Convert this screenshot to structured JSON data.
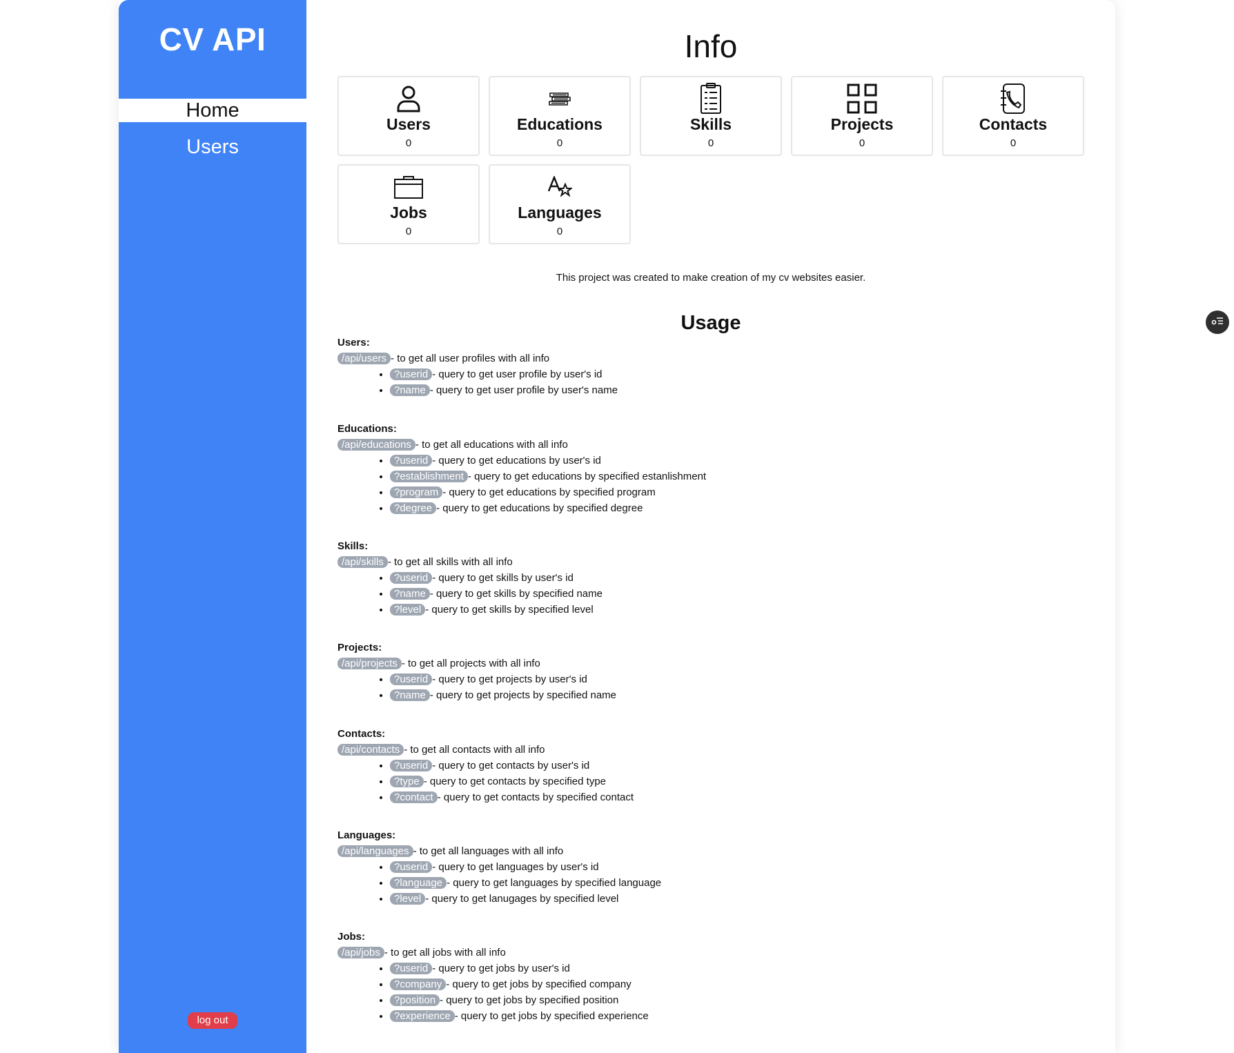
{
  "app": {
    "brand": "CV API"
  },
  "sidebar": {
    "items": [
      {
        "label": "Home",
        "active": true
      },
      {
        "label": "Users",
        "active": false
      }
    ],
    "logout_label": "log out"
  },
  "main": {
    "title": "Info",
    "cards": [
      {
        "label": "Users",
        "count": "0",
        "icon": "user-icon"
      },
      {
        "label": "Educations",
        "count": "0",
        "icon": "books-icon"
      },
      {
        "label": "Skills",
        "count": "0",
        "icon": "clipboard-list-icon"
      },
      {
        "label": "Projects",
        "count": "0",
        "icon": "grid-icon"
      },
      {
        "label": "Contacts",
        "count": "0",
        "icon": "address-book-icon"
      },
      {
        "label": "Jobs",
        "count": "0",
        "icon": "briefcase-icon"
      },
      {
        "label": "Languages",
        "count": "0",
        "icon": "translate-icon"
      }
    ],
    "description": "This project was created to make creation of my cv websites easier.",
    "usage_title": "Usage",
    "sections": [
      {
        "title": "Users:",
        "endpoint": "/api/users",
        "endpoint_desc": "- to get all user profiles with all info",
        "params": [
          {
            "tag": "?userid",
            "desc": "- query to get user profile by user's id"
          },
          {
            "tag": "?name",
            "desc": "- query to get user profile by user's name"
          }
        ]
      },
      {
        "title": "Educations:",
        "endpoint": "/api/educations",
        "endpoint_desc": "- to get all educations with all info",
        "params": [
          {
            "tag": "?userid",
            "desc": "- query to get educations by user's id"
          },
          {
            "tag": "?establishment",
            "desc": "- query to get educations by specified estanlishment"
          },
          {
            "tag": "?program",
            "desc": "- query to get educations by specified program"
          },
          {
            "tag": "?degree",
            "desc": "- query to get educations by specified degree"
          }
        ]
      },
      {
        "title": "Skills:",
        "endpoint": "/api/skills",
        "endpoint_desc": "- to get all skills with all info",
        "params": [
          {
            "tag": "?userid",
            "desc": "- query to get skills by user's id"
          },
          {
            "tag": "?name",
            "desc": "- query to get skills by specified name"
          },
          {
            "tag": "?level",
            "desc": "- query to get skills by specified level"
          }
        ]
      },
      {
        "title": "Projects:",
        "endpoint": "/api/projects",
        "endpoint_desc": "- to get all projects with all info",
        "params": [
          {
            "tag": "?userid",
            "desc": "- query to get projects by user's id"
          },
          {
            "tag": "?name",
            "desc": "- query to get projects by specified name"
          }
        ]
      },
      {
        "title": "Contacts:",
        "endpoint": "/api/contacts",
        "endpoint_desc": "- to get all contacts with all info",
        "params": [
          {
            "tag": "?userid",
            "desc": "- query to get contacts by user's id"
          },
          {
            "tag": "?type",
            "desc": "- query to get contacts by specified type"
          },
          {
            "tag": "?contact",
            "desc": "- query to get contacts by specified contact"
          }
        ]
      },
      {
        "title": "Languages:",
        "endpoint": "/api/languages",
        "endpoint_desc": "- to get all languages with all info",
        "params": [
          {
            "tag": "?userid",
            "desc": "- query to get languages by user's id"
          },
          {
            "tag": "?language",
            "desc": "- query to get languages by specified language"
          },
          {
            "tag": "?level",
            "desc": "- query to get lanugages by specified level"
          }
        ]
      },
      {
        "title": "Jobs:",
        "endpoint": "/api/jobs",
        "endpoint_desc": "- to get all jobs with all info",
        "params": [
          {
            "tag": "?userid",
            "desc": "- query to get jobs by user's id"
          },
          {
            "tag": "?company",
            "desc": "- query to get jobs by specified company"
          },
          {
            "tag": "?position",
            "desc": "- query to get jobs by specified position"
          },
          {
            "tag": "?experience",
            "desc": "- query to get jobs by specified experience"
          }
        ]
      }
    ]
  },
  "floating_button": {
    "icon": "chat-toggle-icon"
  },
  "colors": {
    "sidebar": "#3f83f6",
    "tag": "#9ea6b2",
    "logout": "#e23d4a"
  }
}
